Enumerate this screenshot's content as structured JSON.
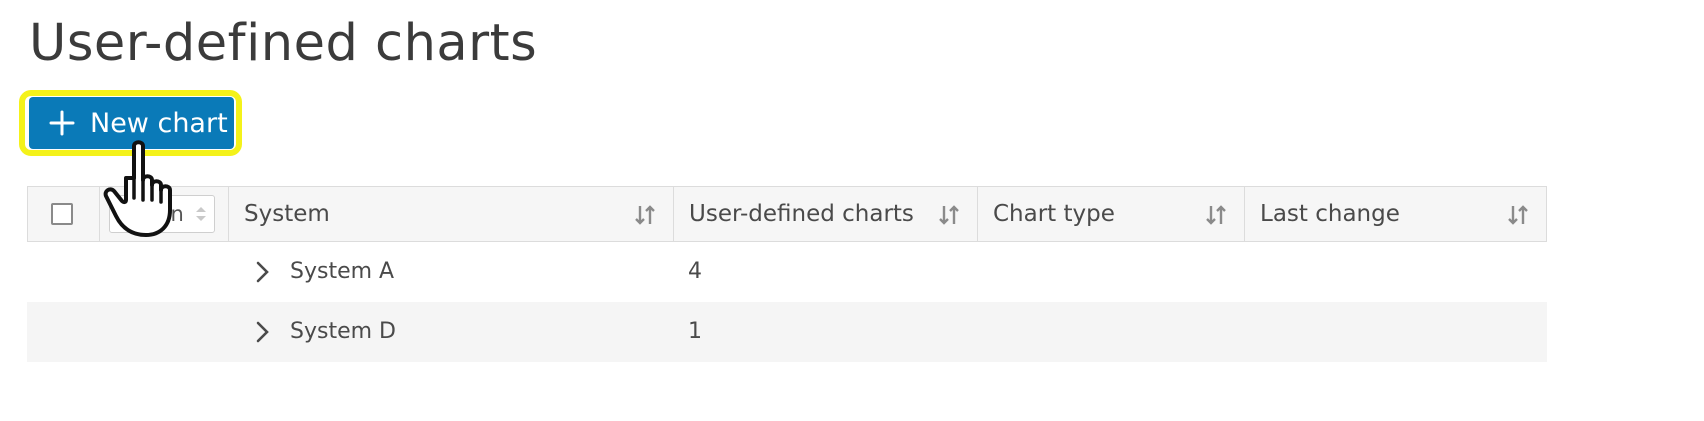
{
  "page": {
    "title": "User-defined charts"
  },
  "toolbar": {
    "new_chart_label": "New chart",
    "new_chart_icon": "plus-icon",
    "button_color": "#0a7ab8",
    "highlight_color": "#f4f21a"
  },
  "table": {
    "action_label": "Action",
    "columns": [
      {
        "label": "System",
        "sort_icon": "sort-icon"
      },
      {
        "label": "User-defined charts",
        "sort_icon": "sort-icon"
      },
      {
        "label": "Chart type",
        "sort_icon": "sort-icon"
      },
      {
        "label": "Last change",
        "sort_icon": "sort-icon"
      }
    ],
    "rows": [
      {
        "system": "System A",
        "charts": "4",
        "chart_type": "",
        "last_change": ""
      },
      {
        "system": "System D",
        "charts": "1",
        "chart_type": "",
        "last_change": ""
      }
    ]
  },
  "cursor": {
    "icon": "hand-pointer-icon"
  }
}
